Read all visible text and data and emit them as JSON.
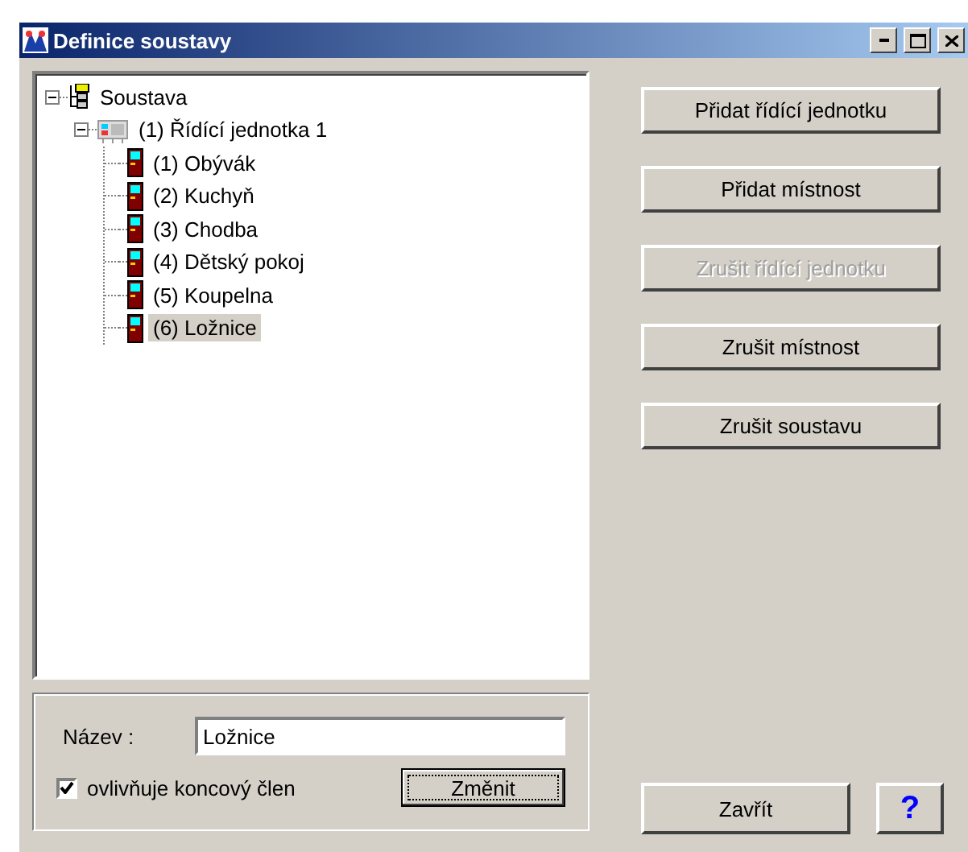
{
  "window": {
    "title": "Definice soustavy"
  },
  "tree": [
    {
      "label": "Soustava",
      "kind": "system",
      "expanded": true,
      "selected": false,
      "children": [
        {
          "label": "(1) Řídící jednotka 1",
          "kind": "unit",
          "expanded": true,
          "selected": false,
          "children": [
            {
              "label": "(1) Obývák",
              "kind": "room",
              "selected": false
            },
            {
              "label": "(2) Kuchyň",
              "kind": "room",
              "selected": false
            },
            {
              "label": "(3) Chodba",
              "kind": "room",
              "selected": false
            },
            {
              "label": "(4) Dětský pokoj",
              "kind": "room",
              "selected": false
            },
            {
              "label": "(5) Koupelna",
              "kind": "room",
              "selected": false
            },
            {
              "label": "(6) Ložnice",
              "kind": "room",
              "selected": true
            }
          ]
        }
      ]
    }
  ],
  "name_field": {
    "label": "Název :",
    "value": "Ložnice"
  },
  "checkbox": {
    "label": "ovlivňuje koncový člen",
    "checked": true
  },
  "change_button": "Změnit",
  "actions": [
    {
      "label": "Přidat řídící jednotku",
      "disabled": false
    },
    {
      "label": "Přidat místnost",
      "disabled": false
    },
    {
      "label": "Zrušit řídící jednotku",
      "disabled": true
    },
    {
      "label": "Zrušit místnost",
      "disabled": false
    },
    {
      "label": "Zrušit soustavu",
      "disabled": false
    }
  ],
  "close_button": "Zavřít",
  "help_button": "?"
}
